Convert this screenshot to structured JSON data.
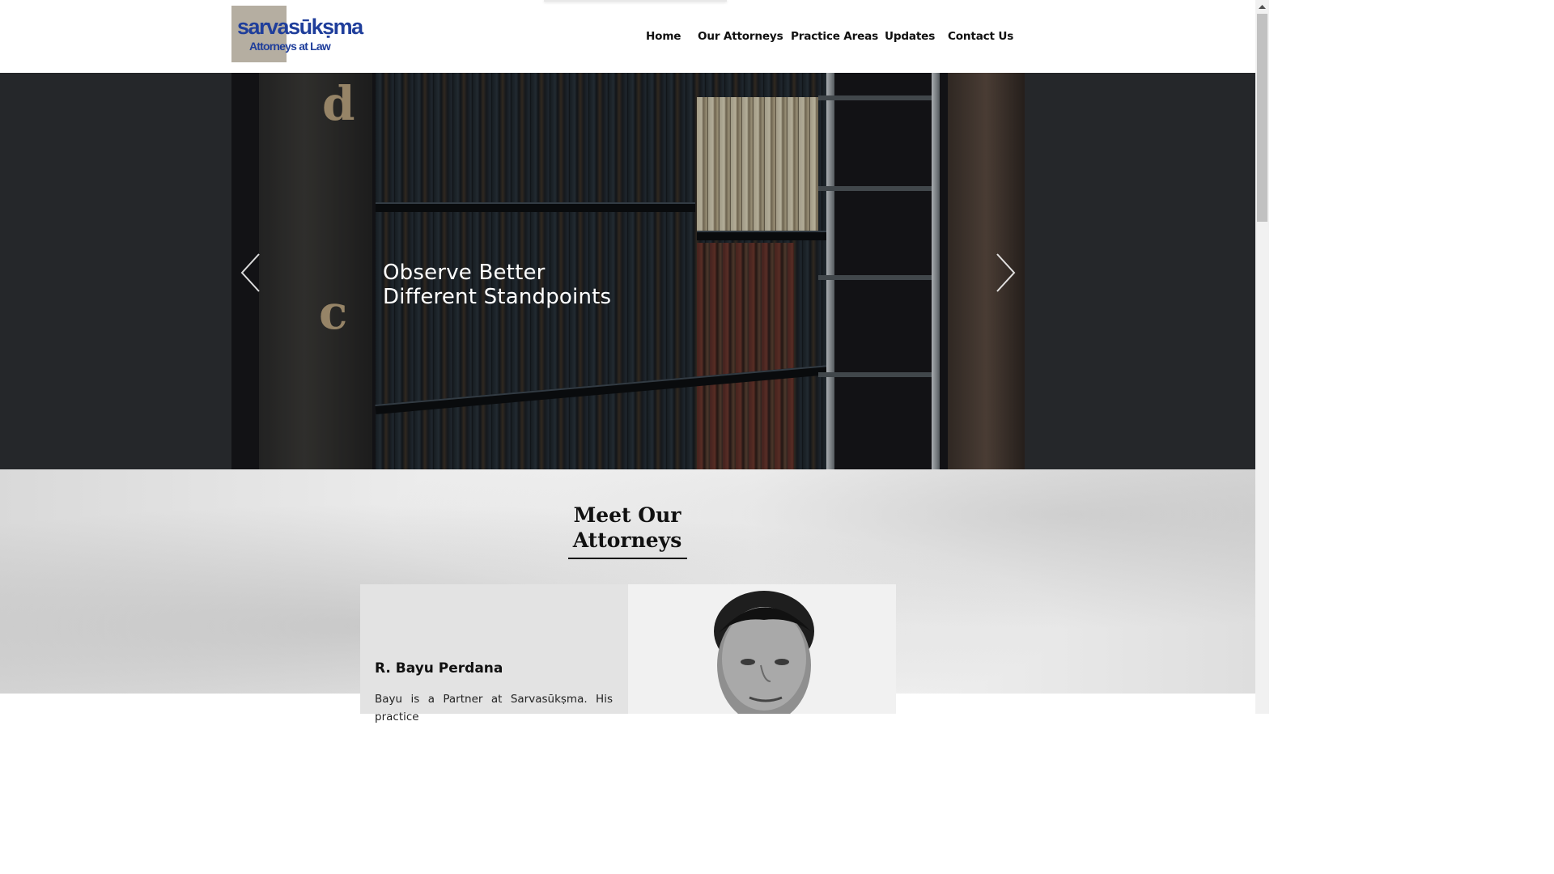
{
  "header": {
    "logo_text": "sarvasūkṣma",
    "logo_subtitle": "Attorneys at Law",
    "nav": [
      {
        "label": "Home"
      },
      {
        "label": "Our Attorneys"
      },
      {
        "label": "Practice Areas"
      },
      {
        "label": "Updates"
      },
      {
        "label": "Contact Us"
      }
    ]
  },
  "hero": {
    "line1": "Observe Better",
    "line2": "Different Standpoints"
  },
  "attorneys": {
    "title_line1": "Meet Our",
    "title_line2": "Attorneys",
    "card": {
      "name": "R. Bayu Perdana",
      "bio": "Bayu is a Partner at Sarvasūkṣma. His practice"
    }
  },
  "colors": {
    "brand_blue": "#1f3e9b",
    "hero_bg": "#25272a"
  },
  "icons": [
    "chevron-left-icon",
    "chevron-right-icon",
    "scroll-up-arrow-icon"
  ]
}
